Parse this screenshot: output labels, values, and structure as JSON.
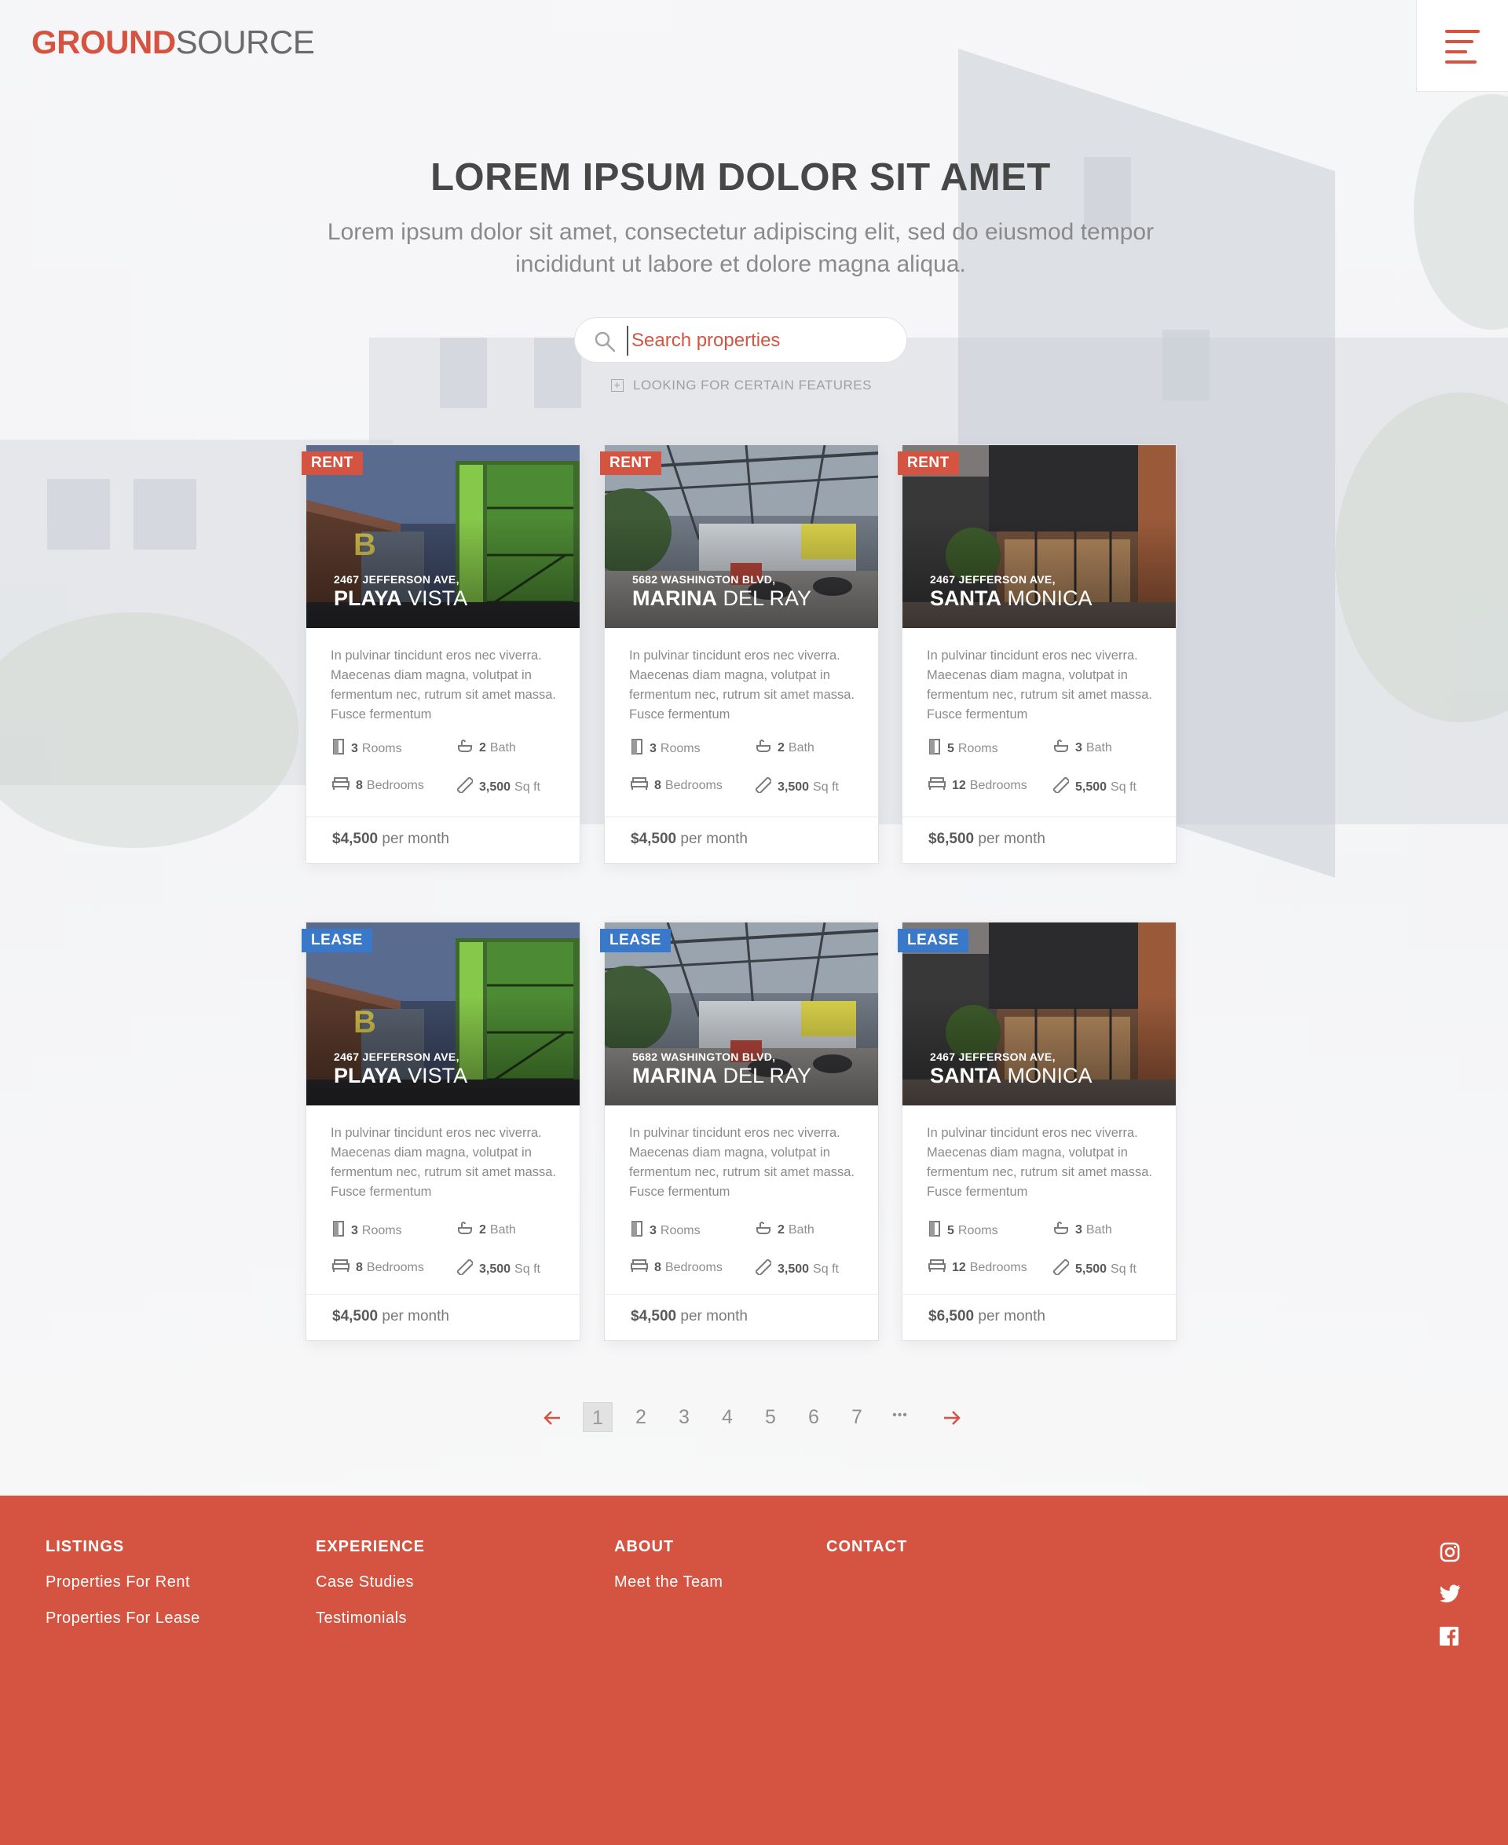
{
  "brand": {
    "bold": "GROUND",
    "light": "SOURCE",
    "accent": "#d45341"
  },
  "header": {
    "menu_icon": "hamburger-menu-icon"
  },
  "hero": {
    "title": "LOREM IPSUM DOLOR SIT AMET",
    "subtitle": "Lorem ipsum dolor sit amet, consectetur adipiscing elit, sed do eiusmod tempor incididunt ut labore et dolore magna aliqua."
  },
  "search": {
    "placeholder": "Search properties",
    "features_label": "LOOKING FOR CERTAIN FEATURES",
    "icon": "search-icon"
  },
  "listings": [
    {
      "tag": "RENT",
      "address": "2467 JEFFERSON AVE,",
      "city_bold": "PLAYA",
      "city_light": "VISTA",
      "description": "In pulvinar tincidunt eros nec viverra. Maecenas diam magna, volutpat in fermentum nec, rutrum sit amet massa. Fusce fermentum",
      "rooms": "3",
      "rooms_label": "Rooms",
      "baths": "2",
      "baths_label": "Bath",
      "bedrooms": "8",
      "bedrooms_label": "Bedrooms",
      "sqft": "3,500",
      "sqft_label": "Sq ft",
      "price": "$4,500",
      "price_suffix": "per month",
      "scene": "playa"
    },
    {
      "tag": "RENT",
      "address": "5682 WASHINGTON BLVD,",
      "city_bold": "MARINA",
      "city_light": "DEL RAY",
      "description": "In pulvinar tincidunt eros nec viverra. Maecenas diam magna, volutpat in fermentum nec, rutrum sit amet massa. Fusce fermentum",
      "rooms": "3",
      "rooms_label": "Rooms",
      "baths": "2",
      "baths_label": "Bath",
      "bedrooms": "8",
      "bedrooms_label": "Bedrooms",
      "sqft": "3,500",
      "sqft_label": "Sq ft",
      "price": "$4,500",
      "price_suffix": "per month",
      "scene": "marina"
    },
    {
      "tag": "RENT",
      "address": "2467 JEFFERSON AVE,",
      "city_bold": "SANTA",
      "city_light": "MONICA",
      "description": "In pulvinar tincidunt eros nec viverra. Maecenas diam magna, volutpat in fermentum nec, rutrum sit amet massa. Fusce fermentum",
      "rooms": "5",
      "rooms_label": "Rooms",
      "baths": "3",
      "baths_label": "Bath",
      "bedrooms": "12",
      "bedrooms_label": "Bedrooms",
      "sqft": "5,500",
      "sqft_label": "Sq ft",
      "price": "$6,500",
      "price_suffix": "per month",
      "scene": "santa"
    },
    {
      "tag": "LEASE",
      "address": "2467 JEFFERSON AVE,",
      "city_bold": "PLAYA",
      "city_light": "VISTA",
      "description": "In pulvinar tincidunt eros nec viverra. Maecenas diam magna, volutpat in fermentum nec, rutrum sit amet massa. Fusce fermentum",
      "rooms": "3",
      "rooms_label": "Rooms",
      "baths": "2",
      "baths_label": "Bath",
      "bedrooms": "8",
      "bedrooms_label": "Bedrooms",
      "sqft": "3,500",
      "sqft_label": "Sq ft",
      "price": "$4,500",
      "price_suffix": "per month",
      "scene": "playa"
    },
    {
      "tag": "LEASE",
      "address": "5682 WASHINGTON BLVD,",
      "city_bold": "MARINA",
      "city_light": "DEL RAY",
      "description": "In pulvinar tincidunt eros nec viverra. Maecenas diam magna, volutpat in fermentum nec, rutrum sit amet massa. Fusce fermentum",
      "rooms": "3",
      "rooms_label": "Rooms",
      "baths": "2",
      "baths_label": "Bath",
      "bedrooms": "8",
      "bedrooms_label": "Bedrooms",
      "sqft": "3,500",
      "sqft_label": "Sq ft",
      "price": "$4,500",
      "price_suffix": "per month",
      "scene": "marina"
    },
    {
      "tag": "LEASE",
      "address": "2467 JEFFERSON AVE,",
      "city_bold": "SANTA",
      "city_light": "MONICA",
      "description": "In pulvinar tincidunt eros nec viverra. Maecenas diam magna, volutpat in fermentum nec, rutrum sit amet massa. Fusce fermentum",
      "rooms": "5",
      "rooms_label": "Rooms",
      "baths": "3",
      "baths_label": "Bath",
      "bedrooms": "12",
      "bedrooms_label": "Bedrooms",
      "sqft": "5,500",
      "sqft_label": "Sq ft",
      "price": "$6,500",
      "price_suffix": "per month",
      "scene": "santa"
    }
  ],
  "tag_colors": {
    "RENT": "#d45341",
    "LEASE": "#3a78c9"
  },
  "pagination": {
    "pages": [
      "1",
      "2",
      "3",
      "4",
      "5",
      "6",
      "7"
    ],
    "ellipsis": "•••",
    "current": "1"
  },
  "footer": {
    "background": "#d45341",
    "columns": [
      {
        "heading": "LISTINGS",
        "links": [
          "Properties For Rent",
          "Properties For Lease"
        ]
      },
      {
        "heading": "EXPERIENCE",
        "links": [
          "Case Studies",
          "Testimonials"
        ]
      },
      {
        "heading": "ABOUT",
        "links": [
          "Meet the Team"
        ]
      },
      {
        "heading": "CONTACT",
        "links": []
      }
    ],
    "social": [
      "instagram-icon",
      "twitter-icon",
      "facebook-icon"
    ]
  }
}
